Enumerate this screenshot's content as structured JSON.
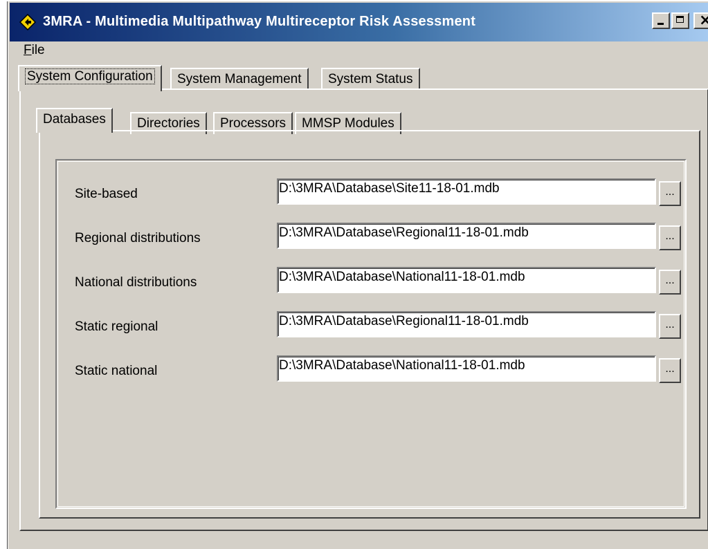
{
  "window": {
    "title": "3MRA - Multimedia Multipathway Multireceptor Risk Assessment",
    "icon": "diamond-app-icon",
    "controls": {
      "minimize": "minimize",
      "maximize": "maximize",
      "close": "close"
    }
  },
  "menu": {
    "file": "File"
  },
  "main_tabs": [
    {
      "label": "System Configuration",
      "active": true
    },
    {
      "label": "System Management",
      "active": false
    },
    {
      "label": "System Status",
      "active": false
    }
  ],
  "sub_tabs": [
    {
      "label": "Databases",
      "active": true
    },
    {
      "label": "Directories",
      "active": false
    },
    {
      "label": "Processors",
      "active": false
    },
    {
      "label": "MMSP Modules",
      "active": false
    }
  ],
  "databases": [
    {
      "label": "Site-based",
      "path": "D:\\3MRA\\Database\\Site11-18-01.mdb",
      "browse": "..."
    },
    {
      "label": "Regional distributions",
      "path": "D:\\3MRA\\Database\\Regional11-18-01.mdb",
      "browse": "..."
    },
    {
      "label": "National distributions",
      "path": "D:\\3MRA\\Database\\National11-18-01.mdb",
      "browse": "..."
    },
    {
      "label": "Static regional",
      "path": "D:\\3MRA\\Database\\Regional11-18-01.mdb",
      "browse": "..."
    },
    {
      "label": "Static national",
      "path": "D:\\3MRA\\Database\\National11-18-01.mdb",
      "browse": "..."
    }
  ],
  "colors": {
    "title_start": "#0a246a",
    "title_end": "#a6caf0",
    "face": "#d4d0c8"
  }
}
